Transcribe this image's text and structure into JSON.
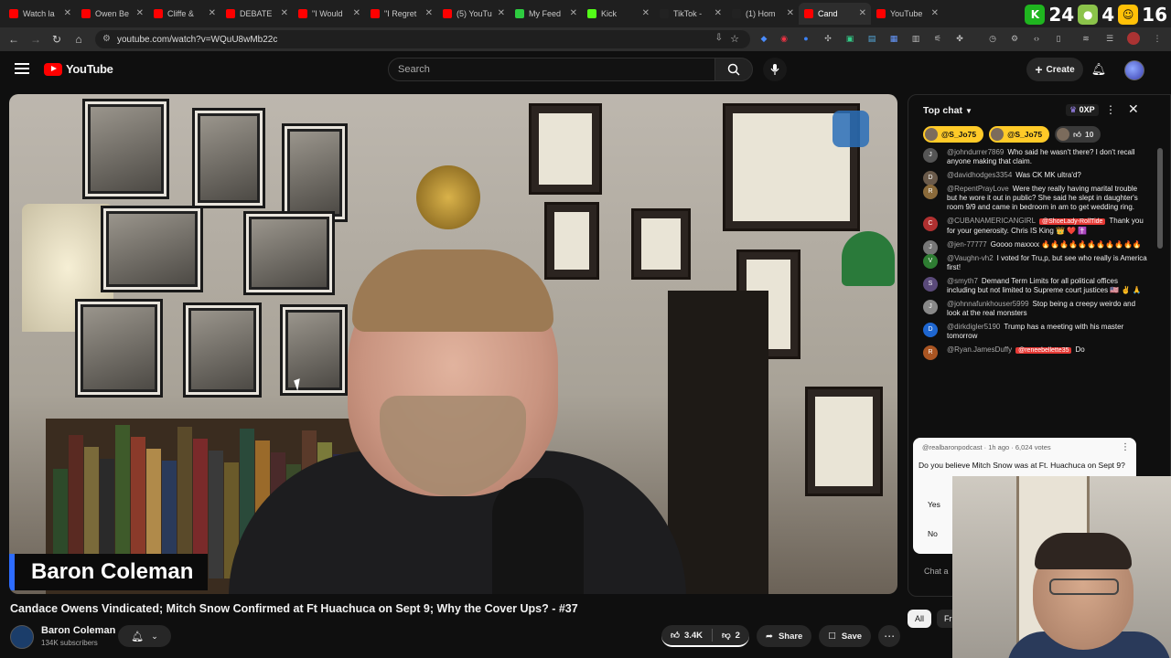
{
  "browser": {
    "tabs": [
      {
        "label": "Watch la",
        "color": "#ff0000"
      },
      {
        "label": "Owen Be",
        "color": "#ff0000"
      },
      {
        "label": "Cliffe &",
        "color": "#ff0000"
      },
      {
        "label": "DEBATE",
        "color": "#ff0000"
      },
      {
        "label": "\"I Would",
        "color": "#ff0000"
      },
      {
        "label": "\"I Regret",
        "color": "#ff0000"
      },
      {
        "label": "(5) YouTu",
        "color": "#ff0000"
      },
      {
        "label": "My Feed",
        "color": "#2ecc40"
      },
      {
        "label": "Kick",
        "color": "#53fc18"
      },
      {
        "label": "TikTok -",
        "color": "#222222"
      },
      {
        "label": "(1) Hom",
        "color": "#222222"
      },
      {
        "label": "Cand",
        "color": "#ff0000"
      },
      {
        "label": "YouTube",
        "color": "#ff0000"
      }
    ],
    "active_tab_index": 11,
    "ticker_overlay": {
      "left_number": "24",
      "mid_number": "4",
      "right_number": "16"
    },
    "url": "youtube.com/watch?v=WQuU8wMb22c"
  },
  "youtube": {
    "logo_text": "YouTube",
    "search_placeholder": "Search",
    "create_label": "Create",
    "video": {
      "lower_third_name": "Baron Coleman",
      "title": "Candace Owens Vindicated; Mitch Snow Confirmed at Ft Huachuca on Sept 9; Why the Cover Ups? - #37"
    },
    "channel": {
      "name": "Baron Coleman",
      "subscribers": "134K subscribers"
    },
    "actions": {
      "likes": "3.4K",
      "dislikes": "2",
      "share": "Share",
      "save": "Save"
    },
    "chat": {
      "header": "Top chat",
      "xp_badge": "0XP",
      "tickers": [
        "@S_Jo75",
        "@S_Jo75",
        "10"
      ],
      "messages": [
        {
          "author": "@johndurrer7869",
          "text": "Who said he wasn't there? I don't recall anyone making that claim.",
          "initial": "J",
          "color": "#555555"
        },
        {
          "author": "@davidhodges3354",
          "text": "Was CK MK ultra'd?",
          "initial": "D",
          "color": "#6a5a4a"
        },
        {
          "author": "@RepentPrayLove",
          "text": "Were they really having marital trouble but he wore it out in public? She said he slept in daughter's room 9/9 and came in bedroom in am to get wedding ring.",
          "initial": "R",
          "color": "#8a6a3a"
        },
        {
          "author": "@CUBANAMERICANGIRL",
          "tag": "@ShoeLady-RollTide",
          "text": "Thank you for your generosity. Chris IS King 👑 ❤️ ✝️",
          "initial": "C",
          "color": "#b03030"
        },
        {
          "author": "@jen-77777",
          "text": "Goooo maxxxx 🔥🔥🔥🔥🔥🔥🔥🔥🔥🔥🔥",
          "initial": "J",
          "color": "#777777"
        },
        {
          "author": "@Vaughn-vh2",
          "text": "I voted for Tru,p, but see who really is America first!",
          "initial": "V",
          "color": "#2e7d32"
        },
        {
          "author": "@smyth7",
          "text": "Demand Term Limits for all political offices including but not limited to Supreme court justices 🇺🇸 ✌️ 🙏",
          "initial": "S",
          "color": "#5a4a7a"
        },
        {
          "author": "@johnnafunkhouser5999",
          "text": "Stop being a creepy weirdo and look at the real monsters",
          "initial": "J",
          "color": "#888888"
        },
        {
          "author": "@dirkdigler5190",
          "text": "Trump has a meeting with his master tomorrow",
          "initial": "D",
          "color": "#1e66d0"
        },
        {
          "author": "@Ryan.JamesDuffy",
          "tag": "@reneebellette35",
          "text": "Do",
          "initial": "R",
          "color": "#aa5522"
        }
      ],
      "poll": {
        "meta": "@realbaronpodcast · 1h ago · 6,024 votes",
        "question": "Do you believe Mitch Snow was at Ft. Huachuca on Sept 9?",
        "options": [
          "Yes",
          "No"
        ]
      },
      "input_placeholder": "Chat a"
    },
    "chips": [
      "All",
      "Fr"
    ]
  }
}
